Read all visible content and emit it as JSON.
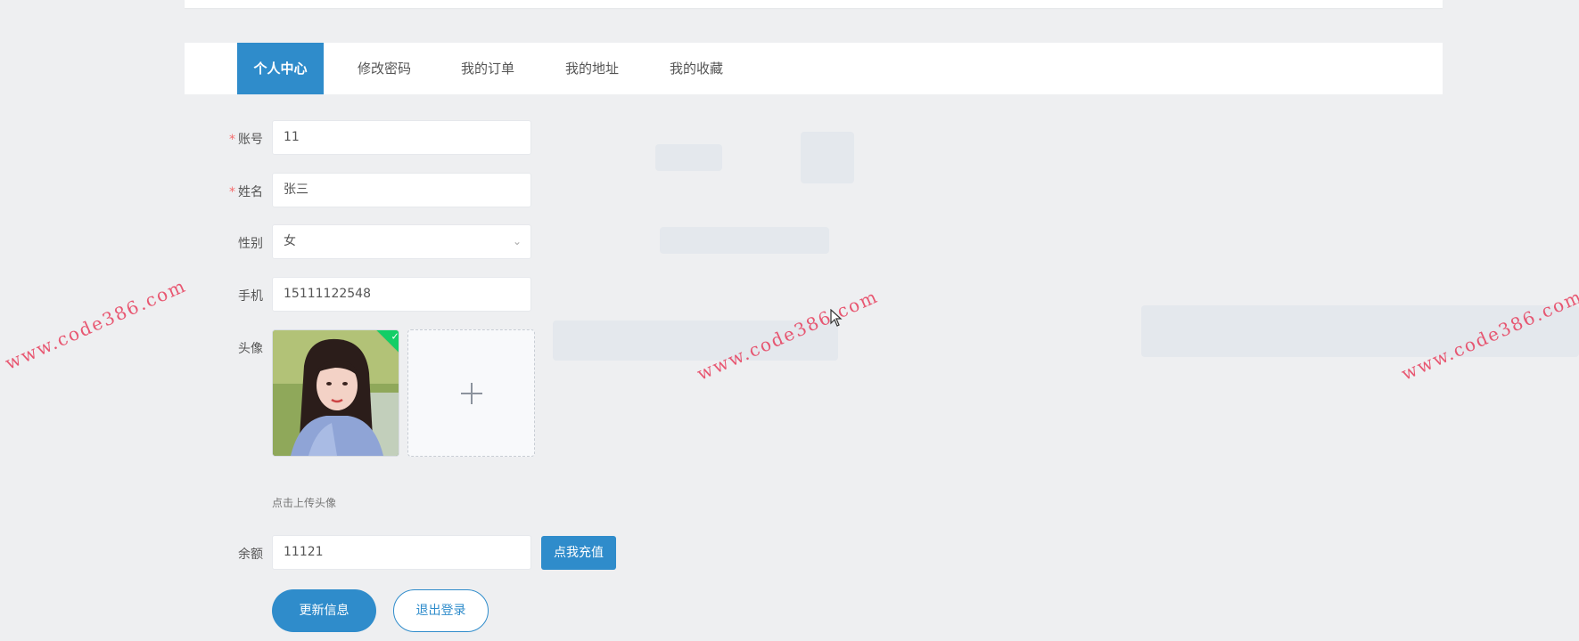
{
  "tabs": [
    {
      "label": "个人中心",
      "active": true
    },
    {
      "label": "修改密码",
      "active": false
    },
    {
      "label": "我的订单",
      "active": false
    },
    {
      "label": "我的地址",
      "active": false
    },
    {
      "label": "我的收藏",
      "active": false
    }
  ],
  "form": {
    "account": {
      "label": "账号",
      "value": "11",
      "required": true
    },
    "name": {
      "label": "姓名",
      "value": "张三",
      "required": true
    },
    "gender": {
      "label": "性别",
      "value": "女"
    },
    "phone": {
      "label": "手机",
      "value": "15111122548"
    },
    "avatar": {
      "label": "头像",
      "hint": "点击上传头像"
    },
    "balance": {
      "label": "余额",
      "value": "11121"
    }
  },
  "buttons": {
    "recharge": "点我充值",
    "update": "更新信息",
    "logout": "退出登录"
  },
  "watermark": "www.code386.com",
  "colors": {
    "accent": "#2f8ccb",
    "required": "#f56c6c",
    "success": "#13ce66",
    "watermark": "#e63c5a"
  }
}
